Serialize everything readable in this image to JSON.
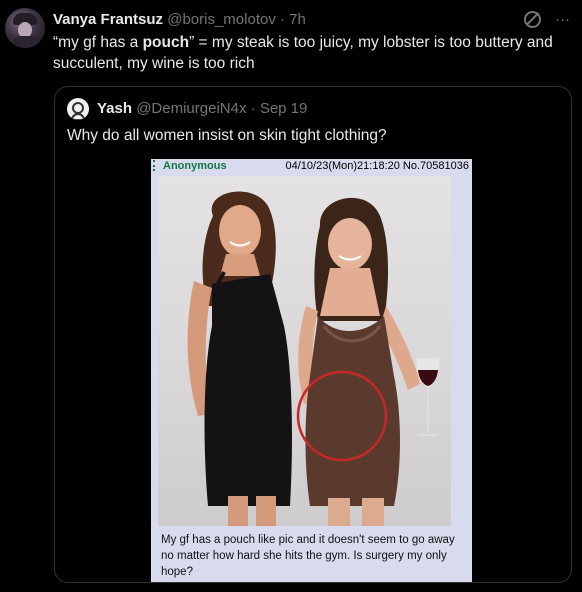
{
  "tweet": {
    "author_name": "Vanya Frantsuz",
    "author_handle": "@boris_molotov",
    "separator": "·",
    "time": "7h",
    "more_icon_glyph": "···",
    "text_before": "“my gf has a ",
    "text_bold": "pouch",
    "text_after": "” = my steak is too juicy, my lobster is too buttery and succulent, my wine is too rich"
  },
  "quote": {
    "author_name": "Yash",
    "author_handle": "@DemiurgeiN4x",
    "separator": "·",
    "date": "Sep 19",
    "text": "Why do all women insist on skin tight clothing?"
  },
  "post_card": {
    "poster": "Anonymous",
    "post_meta": "04/10/23(Mon)21:18:20 No.70581036",
    "caption": "My gf has a pouch like pic and it doesn't seem to go away no matter how hard she hits the gym. Is surgery my only hope?"
  },
  "colors": {
    "background": "#000000",
    "text_primary": "#e7e9ea",
    "text_secondary": "#71767b",
    "border": "#2f3336",
    "card_bg": "#d7dbed",
    "anon_green": "#117743",
    "circle_red": "#c62828"
  },
  "icons": [
    "grok-icon",
    "more-icon",
    "avatar",
    "quote-avatar"
  ]
}
